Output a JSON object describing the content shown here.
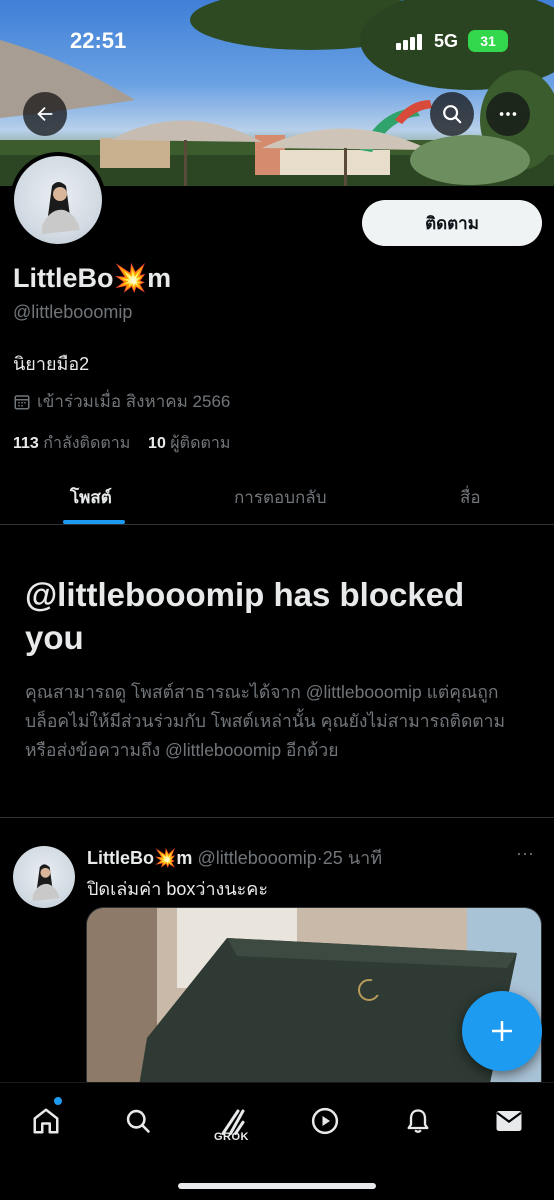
{
  "status_bar": {
    "time": "22:51",
    "network": "5G",
    "battery": "31"
  },
  "profile": {
    "display_name": "LittleBo",
    "display_name_emoji": "💥",
    "display_name_end": "m",
    "handle": "@littlebooomip",
    "bio": "นิยายมือ2",
    "joined": "เข้าร่วมเมื่อ สิงหาคม 2566",
    "following_count": "113",
    "following_label": "กำลังติดตาม",
    "followers_count": "10",
    "followers_label": "ผู้ติดตาม",
    "follow_button": "ติดตาม"
  },
  "tabs": [
    {
      "label": "โพสต์",
      "active": true
    },
    {
      "label": "การตอบกลับ",
      "active": false
    },
    {
      "label": "สื่อ",
      "active": false
    }
  ],
  "blocked": {
    "title": "@littlebooomip has blocked you",
    "description": "คุณสามารถดู โพสต์สาธารณะได้จาก @littlebooomip แต่คุณถูกบล็อคไม่ให้มีส่วนร่วมกับ โพสต์เหล่านั้น คุณยังไม่สามารถติดตามหรือส่งข้อความถึง @littlebooomip อีกด้วย"
  },
  "post": {
    "name": "LittleBo",
    "name_emoji": "💥",
    "name_end": "m",
    "handle": "@littlebooomip",
    "separator": "·",
    "time": "25 นาที",
    "text": "ปิดเล่มค่า boxว่างนะคะ",
    "more": "···"
  },
  "bottom_nav": {
    "items": [
      "home-icon",
      "search-icon",
      "grok-icon",
      "play-icon",
      "bell-icon",
      "mail-icon"
    ],
    "grok_label": "GROK"
  },
  "colors": {
    "accent": "#1d9bf0",
    "background": "#000000",
    "muted": "#71767b",
    "text": "#e7e9ea"
  }
}
